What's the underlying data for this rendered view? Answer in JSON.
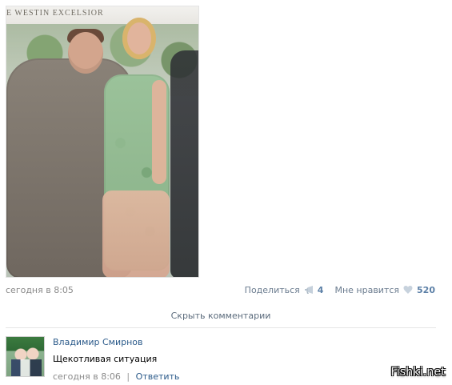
{
  "post": {
    "photo": {
      "banner_text": "E WESTIN EXCELSIOR"
    },
    "time": "сегодня в 8:05",
    "actions": {
      "share_label": "Поделиться",
      "share_count": "4",
      "like_label": "Мне нравится",
      "like_count": "520",
      "share_icon": "megaphone-icon",
      "like_icon": "heart-icon"
    },
    "hide_comments": "Скрыть комментарии"
  },
  "comment": {
    "author": "Владимир Смирнов",
    "text": "Щекотливая ситуация",
    "time": "сегодня в 8:06",
    "separator": "|",
    "reply": "Ответить"
  },
  "watermark": "Fishki.net",
  "colors": {
    "link": "#2b5a8a",
    "muted": "#8a8a8a",
    "divider": "#e5e5e5"
  }
}
